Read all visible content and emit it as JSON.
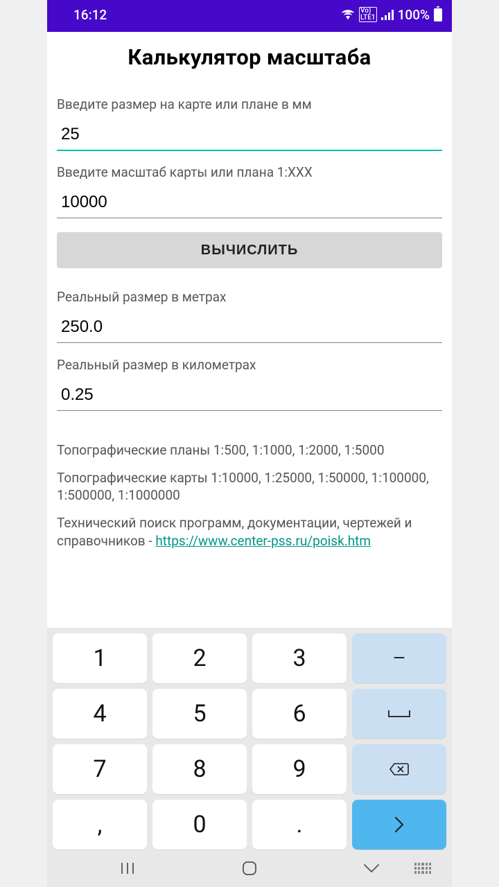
{
  "status": {
    "time": "16:12",
    "battery": "100%"
  },
  "title": "Калькулятор масштаба",
  "fields": {
    "map_size_label": "Введите размер на карте или плане в мм",
    "map_size_value": "25",
    "scale_label": "Введите масштаб карты или плана 1:XXX",
    "scale_value": "10000",
    "meters_label": "Реальный размер в метрах",
    "meters_value": "250.0",
    "km_label": "Реальный размер в километрах",
    "km_value": "0.25"
  },
  "button": {
    "calculate": "ВЫЧИСЛИТЬ"
  },
  "info": {
    "plans": "Топографические планы 1:500, 1:1000, 1:2000, 1:5000",
    "maps": "Топографические карты 1:10000, 1:25000, 1:50000, 1:100000, 1:500000, 1:1000000",
    "search_prefix": "Технический поиск программ, документации, чертежей и справочников - ",
    "search_link": "https://www.center-pss.ru/poisk.htm"
  },
  "keyboard": {
    "k1": "1",
    "k2": "2",
    "k3": "3",
    "minus": "−",
    "k4": "4",
    "k5": "5",
    "k6": "6",
    "space": "␣",
    "k7": "7",
    "k8": "8",
    "k9": "9",
    "bksp": "⌫",
    "comma": ",",
    "k0": "0",
    "dot": ".",
    "go": "›"
  }
}
